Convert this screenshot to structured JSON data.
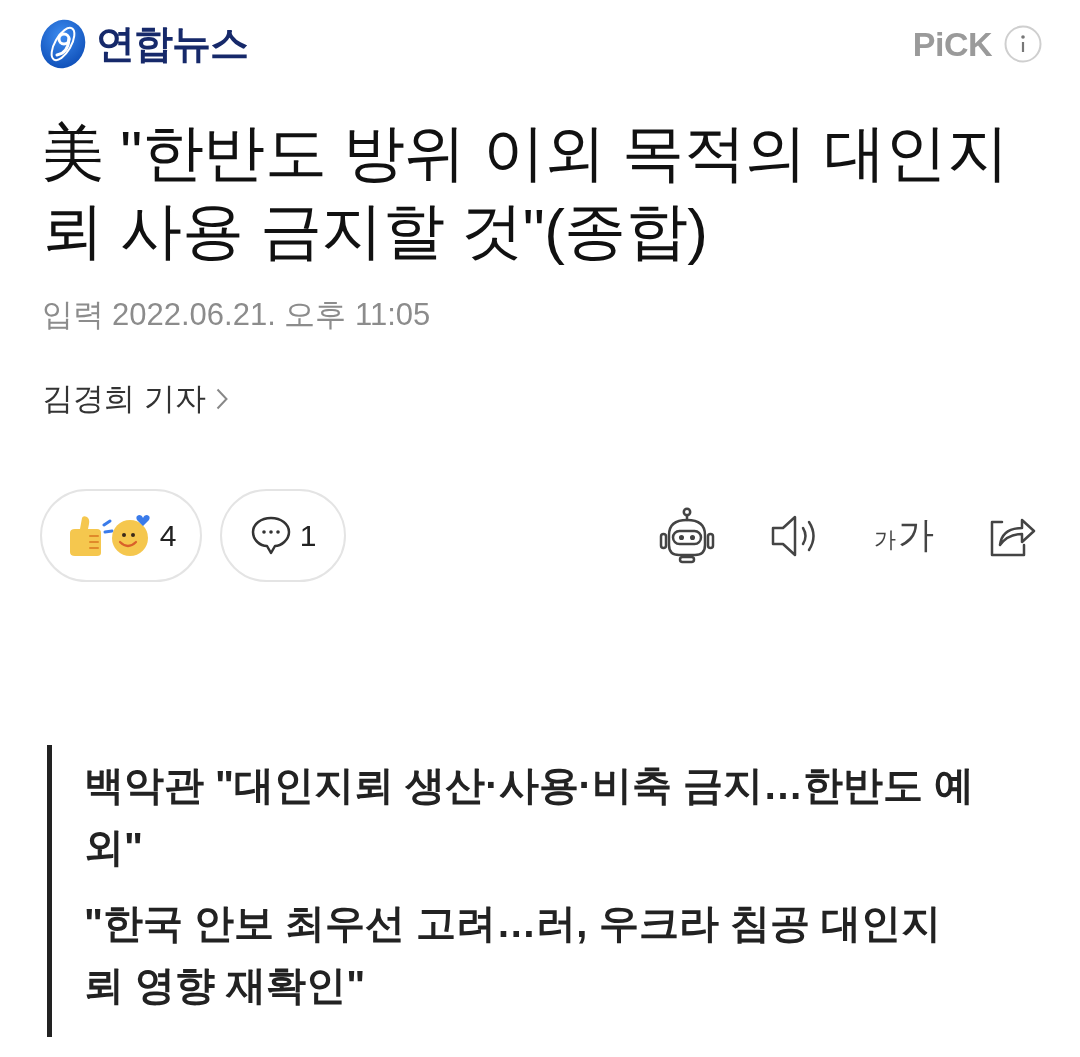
{
  "header": {
    "logo_text": "연합뉴스",
    "pick_label": "PiCK"
  },
  "article": {
    "title": "美 \"한반도 방위 이외 목적의 대인지뢰 사용 금지할 것\"(종합)",
    "date_label": "입력",
    "date": "2022.06.21. 오후 11:05",
    "reporter": "김경희 기자"
  },
  "reactions": {
    "reaction_count": "4",
    "comment_count": "1"
  },
  "tools": {
    "font_size_small": "가",
    "font_size_large": "가"
  },
  "summary": [
    "백악관 \"대인지뢰 생산·사용·비축 금지…한반도 예외\"",
    "\"한국 안보 최우선 고려…러, 우크라 침공 대인지뢰 영향 재확인\""
  ]
}
